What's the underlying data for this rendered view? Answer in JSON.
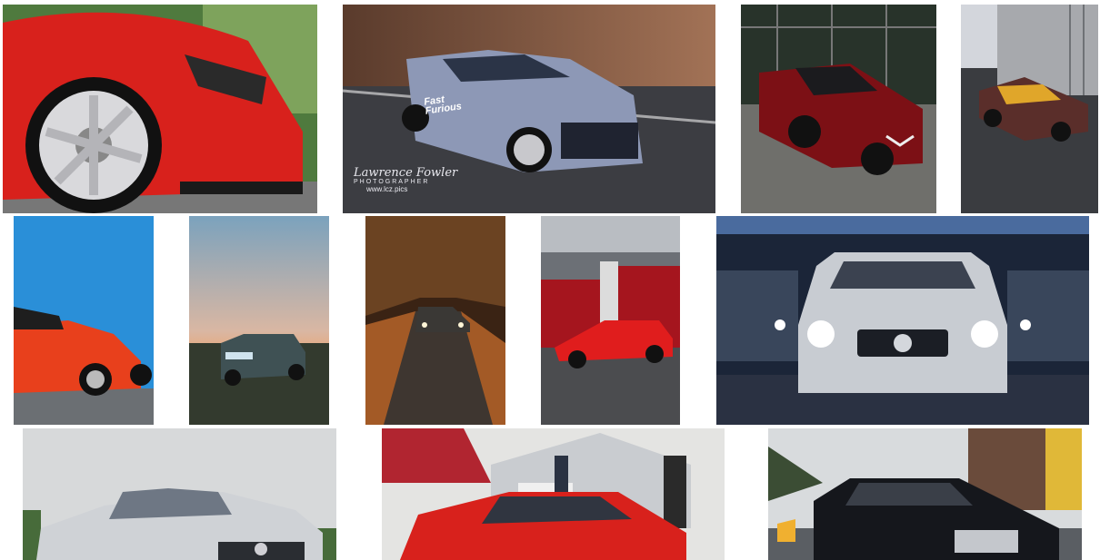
{
  "gallery": {
    "watermark": {
      "name": "Lawrence Fowler",
      "role": "PHOTOGRAPHER",
      "url": "www.lcz.pics"
    },
    "decal_text": "Fast Furious",
    "colors": {
      "red_car": "#d8211c",
      "blue_sky": "#2a8fd8",
      "silver_car": "#c8ccd2",
      "dark_bg": "#1e2126"
    }
  }
}
